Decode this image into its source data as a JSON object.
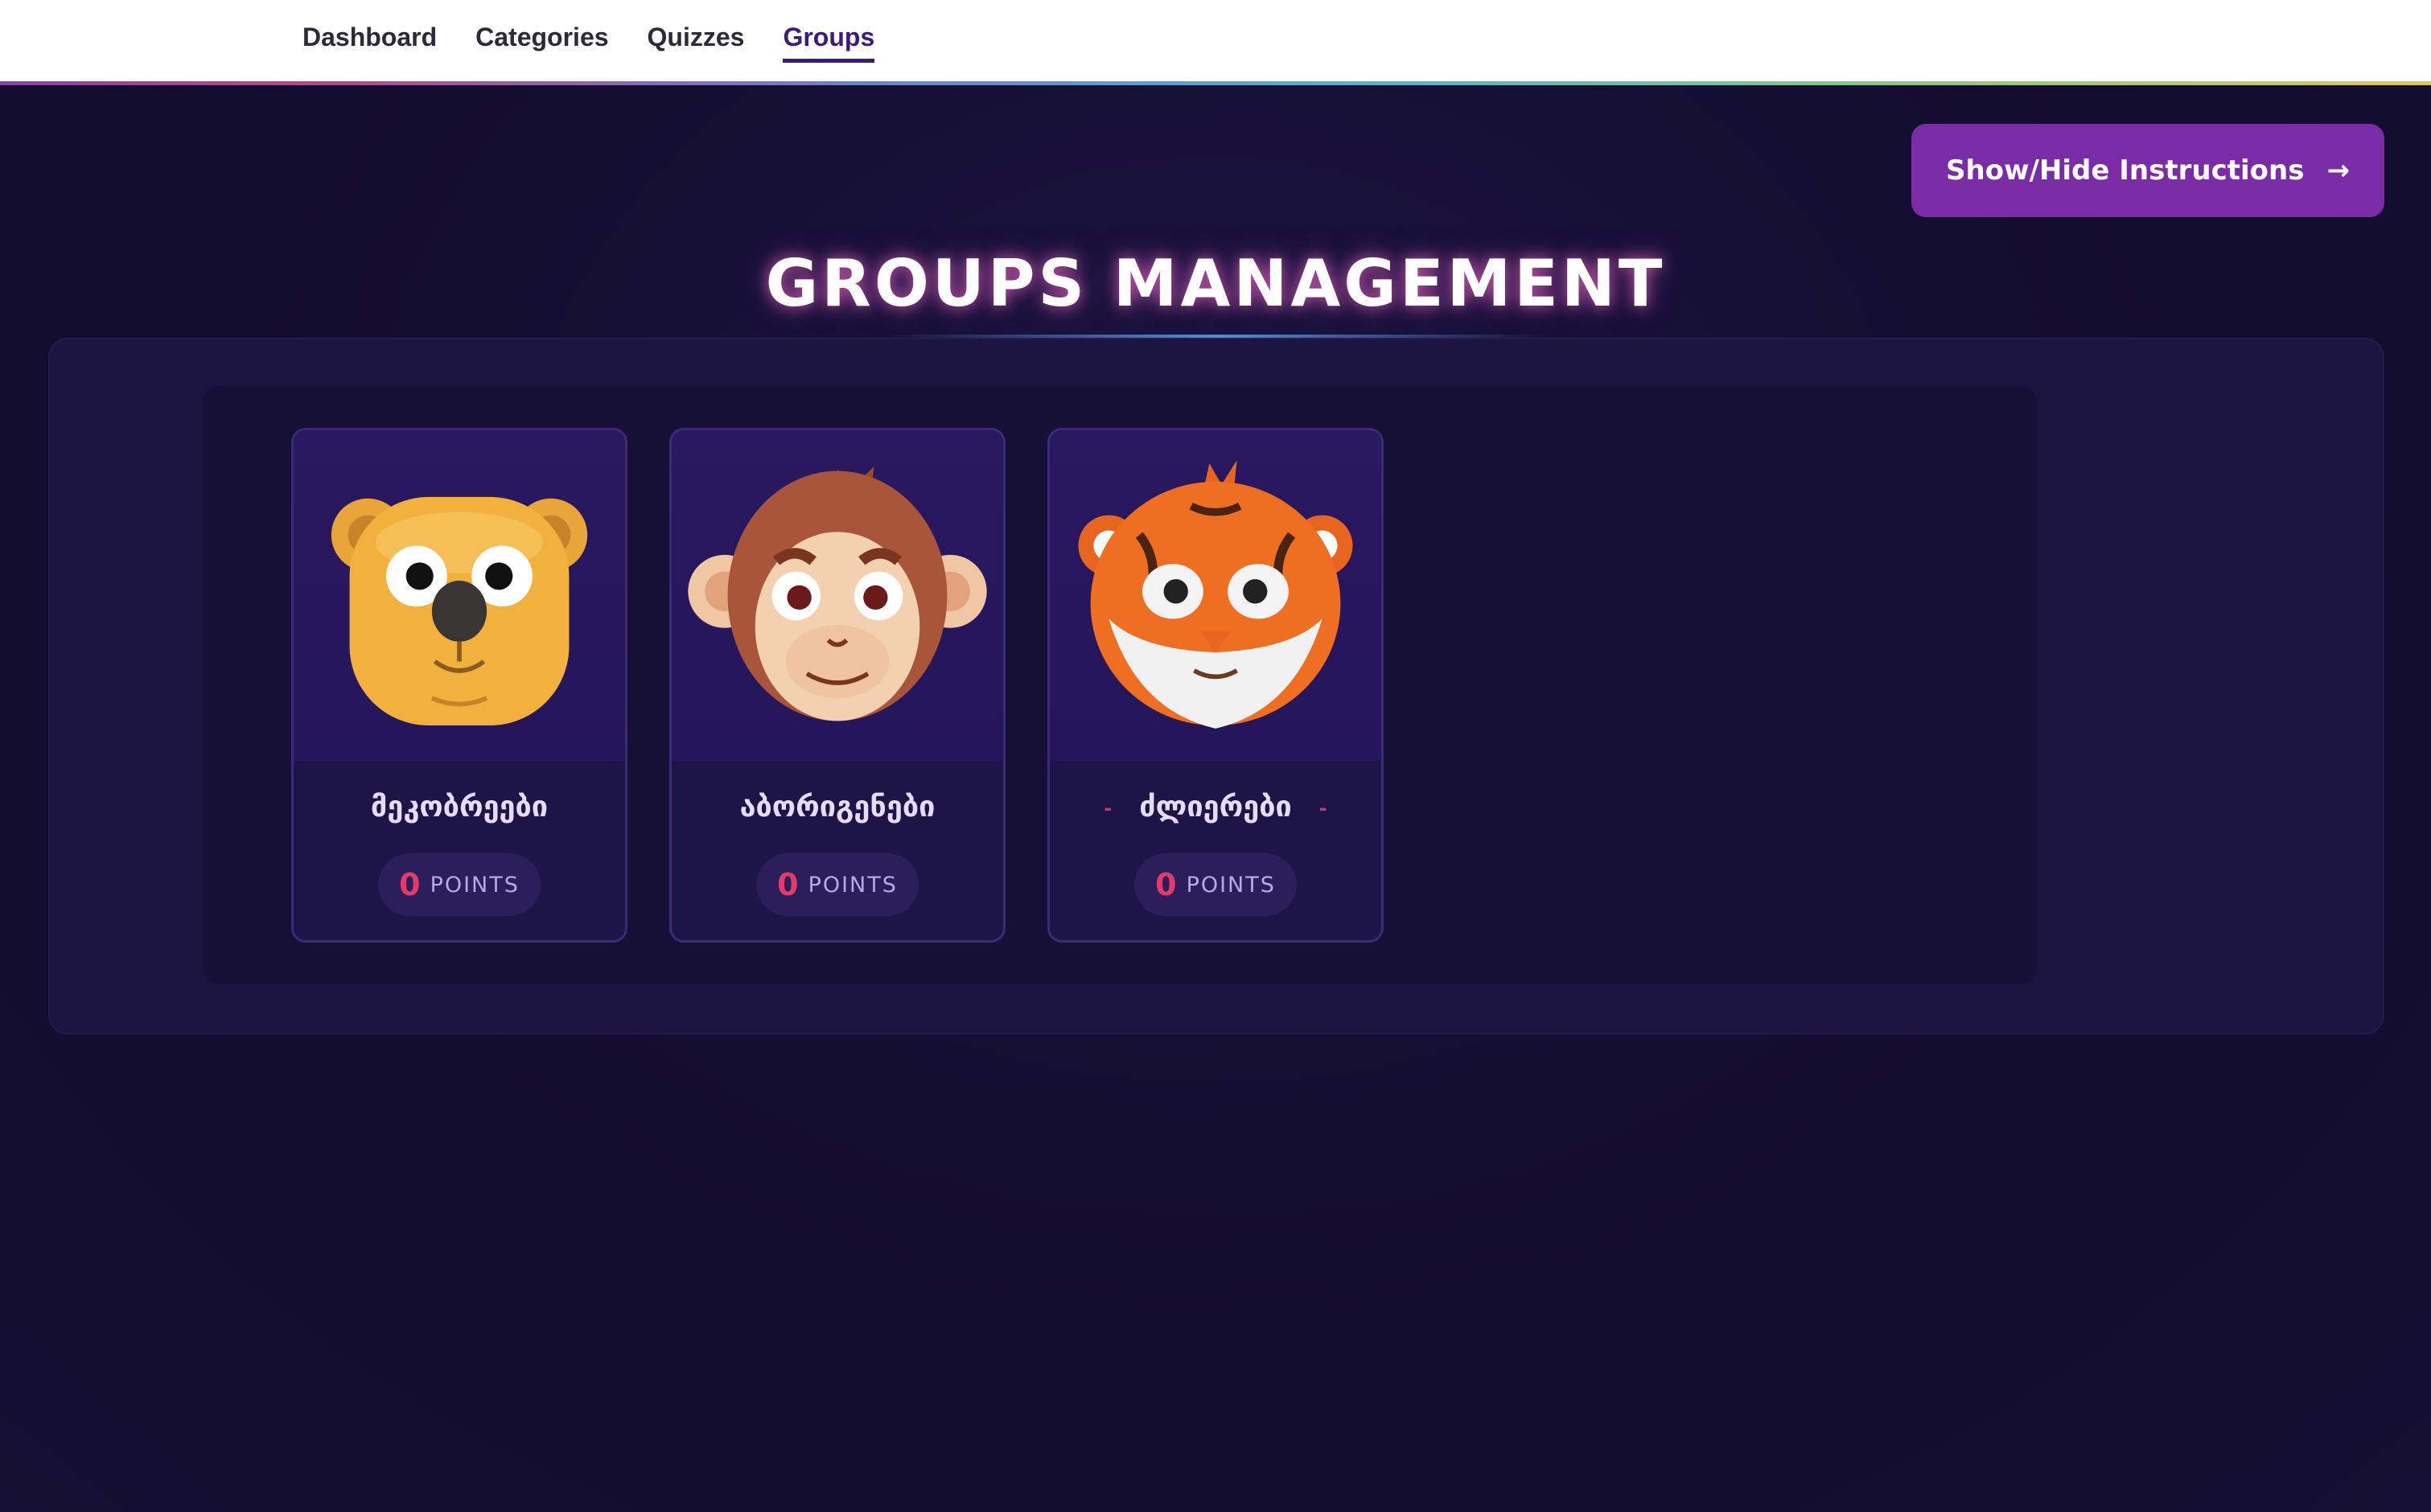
{
  "nav": {
    "items": [
      {
        "label": "Dashboard",
        "active": false
      },
      {
        "label": "Categories",
        "active": false
      },
      {
        "label": "Quizzes",
        "active": false
      },
      {
        "label": "Groups",
        "active": true
      }
    ]
  },
  "header": {
    "instructions_button": {
      "label": "Show/Hide Instructions",
      "icon": "arrow-right-icon"
    },
    "title": "GROUPS MANAGEMENT"
  },
  "colors": {
    "accent_purple": "#7a2ba6",
    "points_red": "#e43a6a",
    "nav_active": "#3b1a7a"
  },
  "groups": [
    {
      "name": "მეკობრეები",
      "points": "0",
      "points_label": "POINTS",
      "avatar": "bear-icon",
      "has_dashes": false
    },
    {
      "name": "აბორიგენები",
      "points": "0",
      "points_label": "POINTS",
      "avatar": "monkey-icon",
      "has_dashes": false
    },
    {
      "name": "ძლიერები",
      "points": "0",
      "points_label": "POINTS",
      "avatar": "tiger-icon",
      "has_dashes": true,
      "dash": "-"
    }
  ]
}
